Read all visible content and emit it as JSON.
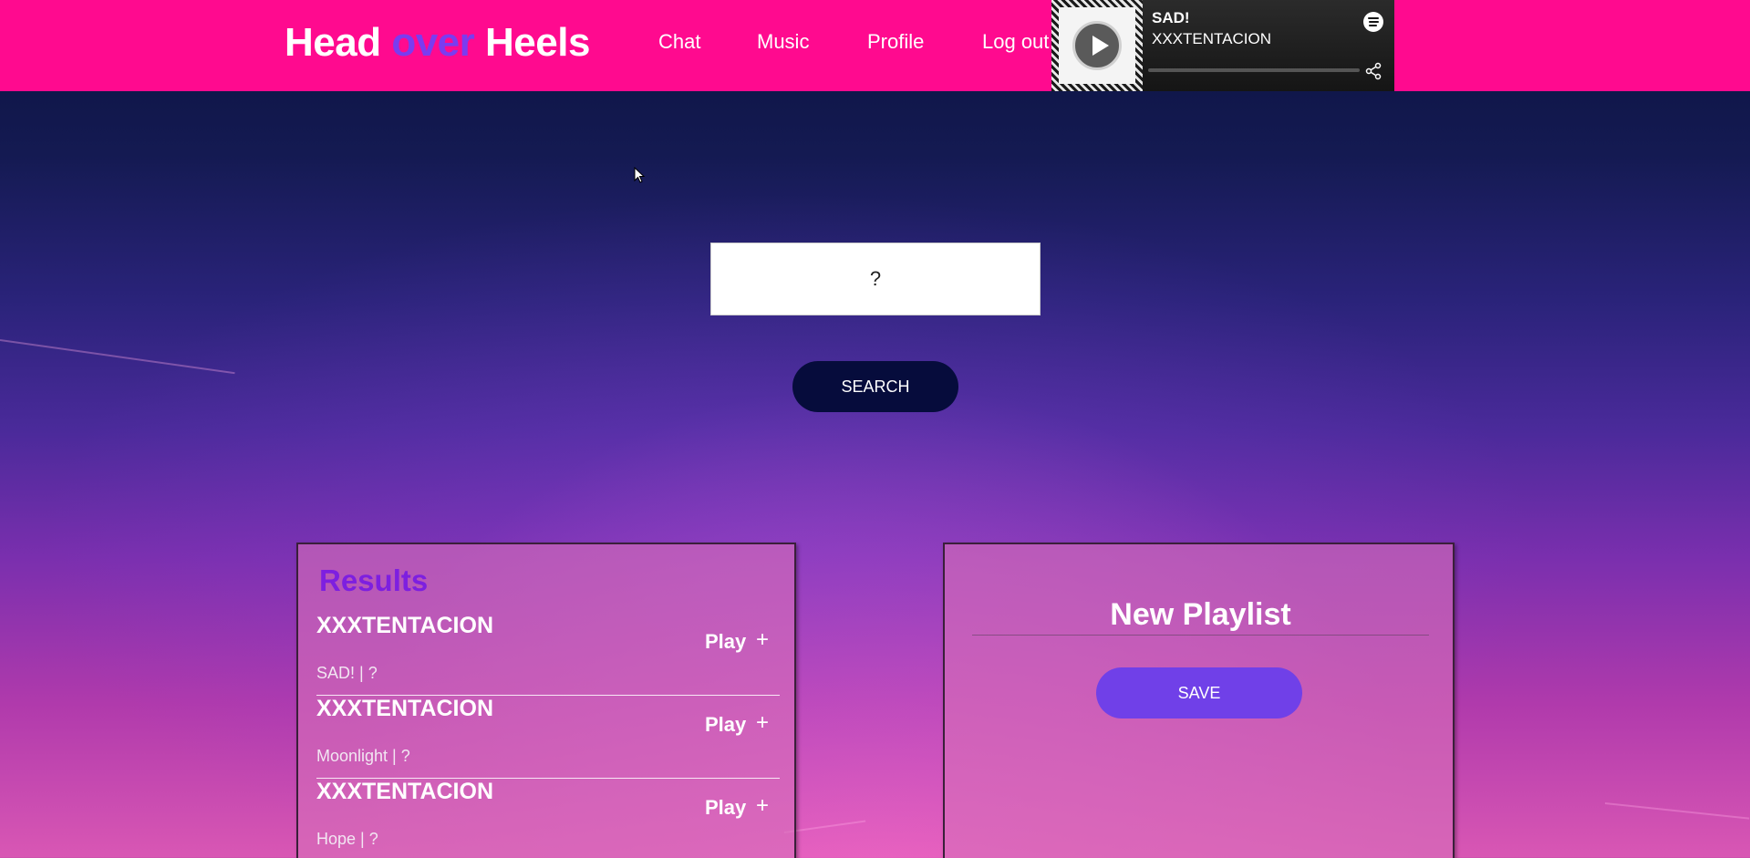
{
  "header": {
    "logo_part1": "Head ",
    "logo_accent": "over",
    "logo_part2": " Heels",
    "nav": [
      "Chat",
      "Music",
      "Profile",
      "Log out"
    ]
  },
  "player": {
    "track": "SAD!",
    "artist": "XXXTENTACION",
    "icons": [
      "play-icon",
      "spotify-icon",
      "share-icon"
    ]
  },
  "search": {
    "value": "?",
    "button_label": "SEARCH"
  },
  "results": {
    "title": "Results",
    "play_label": "Play",
    "add_label": "+",
    "items": [
      {
        "artist": "XXXTENTACION",
        "song": "SAD! | ?"
      },
      {
        "artist": "XXXTENTACION",
        "song": "Moonlight | ?"
      },
      {
        "artist": "XXXTENTACION",
        "song": "Hope | ?"
      }
    ]
  },
  "playlist": {
    "name": "New Playlist",
    "save_label": "SAVE"
  },
  "colors": {
    "header_bg": "#ff0a8f",
    "accent": "#7a3cf0",
    "search_button": "#060c3c",
    "save_button": "#7040e8",
    "results_title": "#7d1fe0"
  }
}
